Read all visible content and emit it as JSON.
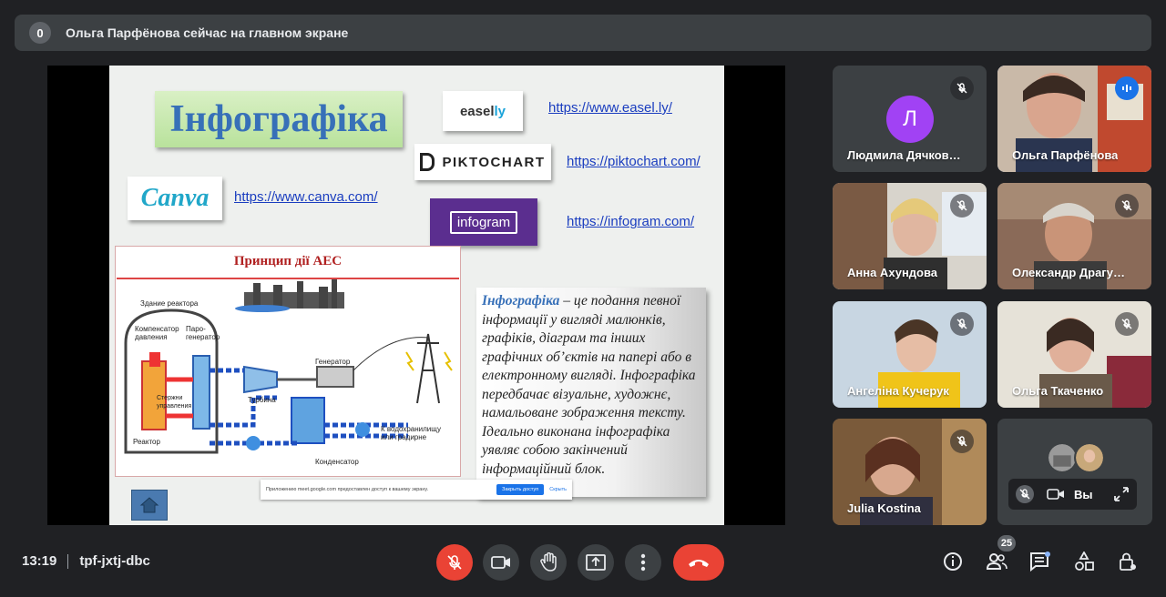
{
  "banner": {
    "count": "0",
    "text": "Ольга Парфёнова сейчас на главном экране"
  },
  "slide": {
    "title": "Інфографіка",
    "logos": {
      "easelly_a": "easel",
      "easelly_b": "ly",
      "piktochart": "PIKTOCHART",
      "canva": "Canva",
      "infogram": "infogram"
    },
    "links": {
      "easelly": "https://www.easel.ly/",
      "piktochart": "https://piktochart.com/",
      "canva": "https://www.canva.com/",
      "infogram": "https://infogram.com/"
    },
    "diagram": {
      "title": "Принцип дії АЕС",
      "labels": {
        "reactor_building": "Здание реактора",
        "pressurizer": "Компенсатор давления",
        "steam_gen": "Паро-генератор",
        "rods": "Стержни управления",
        "reactor": "Реактор",
        "turbine": "Турбина",
        "generator": "Генератор",
        "condenser": "Конденсатор",
        "reservoir": "К водохранилищу или градирне"
      }
    },
    "text_lead": "Інфографіка",
    "text_body": " – це подання певної інформації   у вигляді малюнків, графіків, діаграм та інших графічних об’єктів  на папері або в електронному вигляді. Інфографіка передбачає візуальне,  художнє, намальоване зображення  тексту. Ідеально виконана інфографіка уявляє собою закінчений інформаційний блок.",
    "share_notice": {
      "text": "Приложению meet.google.com предоставлен доступ к вашему экрану.",
      "allow": "Закрыть доступ",
      "hide": "Скрыть"
    }
  },
  "participants": [
    {
      "name": "Людмила Дячков…",
      "initial": "Л",
      "mic": "muted"
    },
    {
      "name": "Ольга Парфёнова",
      "mic": "speaking"
    },
    {
      "name": "Анна Ахундова",
      "mic": "muted"
    },
    {
      "name": "Олександр Драгу…",
      "mic": "muted"
    },
    {
      "name": "Ангеліна Кучерук",
      "mic": "muted"
    },
    {
      "name": "Ольга Ткаченко",
      "mic": "muted"
    },
    {
      "name": "Julia Kostina",
      "mic": "muted"
    }
  ],
  "self": {
    "label": "Вы"
  },
  "bottom": {
    "time": "13:19",
    "code": "tpf-jxtj-dbc",
    "people_count": "25"
  },
  "colors": {
    "accent": "#1a73e8",
    "danger": "#ea4335",
    "bg": "#202124",
    "tile": "#3c4043"
  }
}
